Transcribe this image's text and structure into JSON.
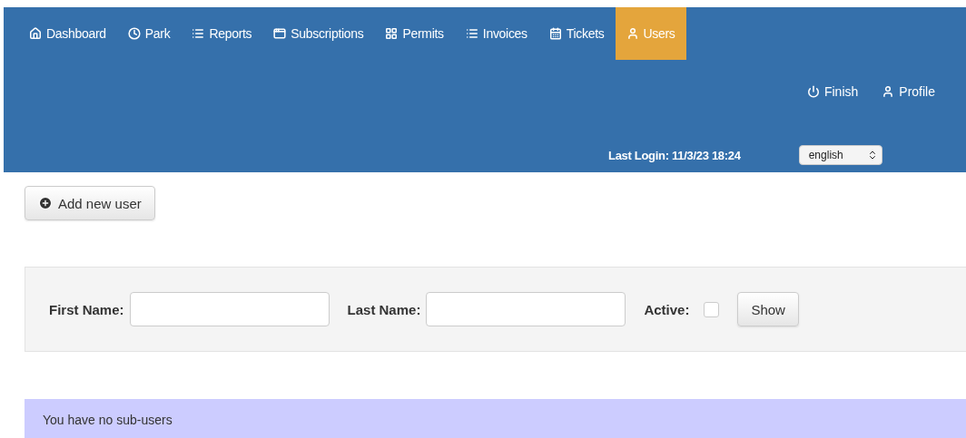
{
  "nav": {
    "items": [
      {
        "label": "Dashboard",
        "selected": false
      },
      {
        "label": "Park",
        "selected": false
      },
      {
        "label": "Reports",
        "selected": false
      },
      {
        "label": "Subscriptions",
        "selected": false
      },
      {
        "label": "Permits",
        "selected": false
      },
      {
        "label": "Invoices",
        "selected": false
      },
      {
        "label": "Tickets",
        "selected": false
      },
      {
        "label": "Users",
        "selected": true
      }
    ]
  },
  "user_links": [
    {
      "label": "Finish"
    },
    {
      "label": "Profile"
    }
  ],
  "last_login": "Last Login: 11/3/23 18:24",
  "language": {
    "value": "english"
  },
  "add_button": {
    "label": "Add new user"
  },
  "filter": {
    "first_name_label": "First Name:",
    "last_name_label": "Last Name:",
    "active_label": "Active:",
    "active_checked": false,
    "show_button": "Show"
  },
  "alert": {
    "text": "You have no sub-users"
  }
}
